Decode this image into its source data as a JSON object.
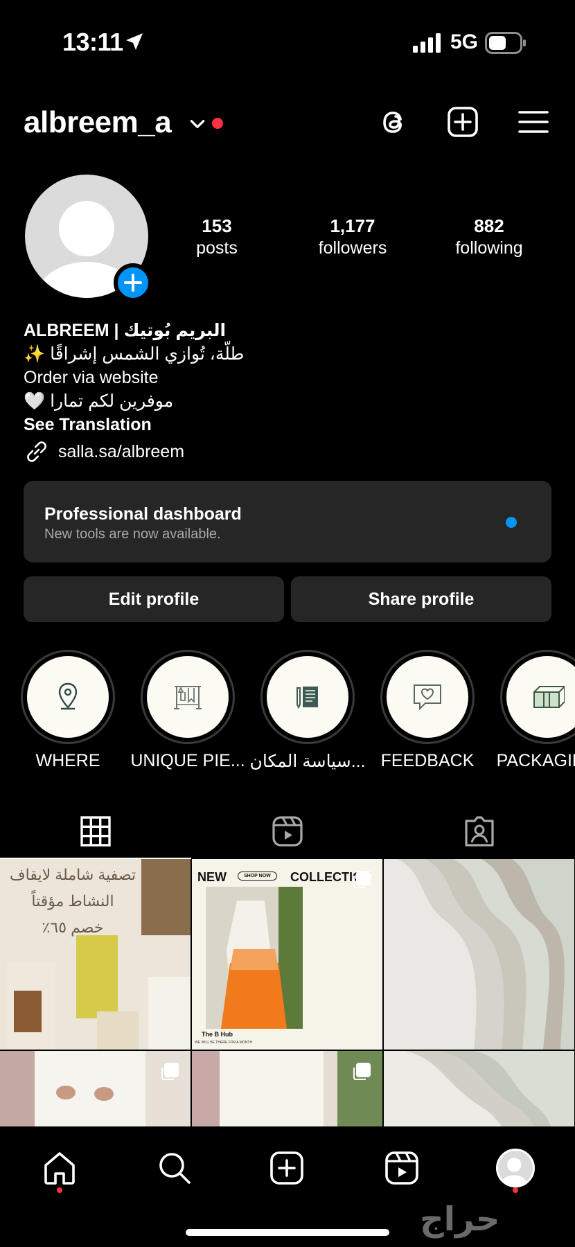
{
  "status_bar": {
    "time": "13:11",
    "network": "5G"
  },
  "header": {
    "username": "albreem_a"
  },
  "profile": {
    "stats": [
      {
        "num": "153",
        "label": "posts"
      },
      {
        "num": "1,177",
        "label": "followers"
      },
      {
        "num": "882",
        "label": "following"
      }
    ],
    "bio": {
      "name": "ALBREEM | البريم بُوتيك",
      "line1": "طلّة، تُوازي الشمس إشراقًا ✨",
      "line2": "Order via website",
      "line3": "موفرين لكم تمارا 🤍",
      "see_translation": "See Translation",
      "link": "salla.sa/albreem"
    }
  },
  "dashboard": {
    "title": "Professional dashboard",
    "subtitle": "New tools are now available."
  },
  "buttons": {
    "edit": "Edit profile",
    "share": "Share profile"
  },
  "highlights": [
    {
      "label": "WHERE",
      "icon": "location-pin-icon"
    },
    {
      "label": "UNIQUE PIE...",
      "icon": "clothes-rack-icon"
    },
    {
      "label": "سياسة المكان...",
      "icon": "document-pen-icon"
    },
    {
      "label": "FEEDBACK",
      "icon": "chat-heart-icon"
    },
    {
      "label": "PACKAGING",
      "icon": "gift-box-icon"
    }
  ],
  "grid": {
    "post1_lines": [
      "تصفية شاملة لايقاف",
      "النشاط مؤقتاً",
      "خصم ٦٥٪"
    ],
    "post2_new": "NEW",
    "post2_collection": "COLLECTION",
    "post2_shop": "SHOP NOW",
    "post2_brand": "The B Hub",
    "post2_footer": "WE WILL BE THERE FOR A MONTH"
  },
  "watermark": "حراج",
  "colors": {
    "accent": "#0095f6",
    "notification": "#ff3040",
    "surface": "#262626"
  }
}
